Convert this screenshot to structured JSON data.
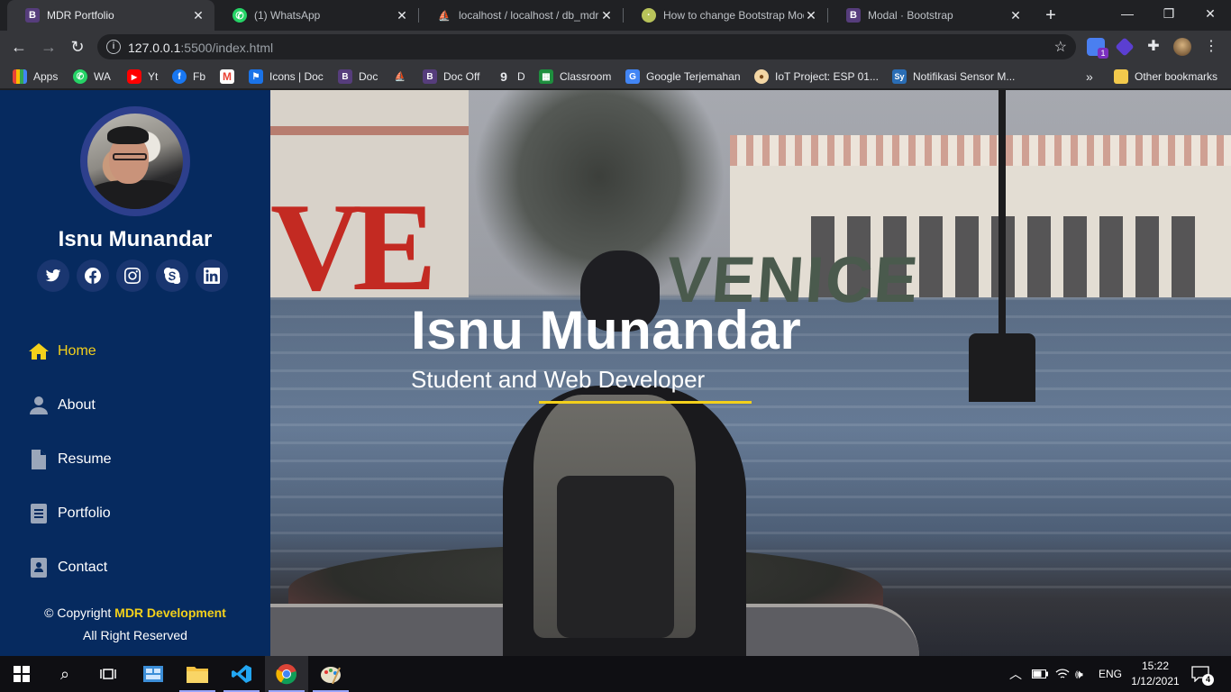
{
  "browser": {
    "tabs": [
      {
        "title": "MDR Portfolio",
        "icon": "bootstrap-icon",
        "active": true
      },
      {
        "title": "(1) WhatsApp",
        "icon": "whatsapp-icon",
        "active": false
      },
      {
        "title": "localhost / localhost / db_mdr",
        "icon": "phpmyadmin-icon",
        "active": false
      },
      {
        "title": "How to change Bootstrap Moda",
        "icon": "stackoverflow-icon",
        "active": false
      },
      {
        "title": "Modal · Bootstrap",
        "icon": "bootstrap-icon",
        "active": false
      }
    ],
    "url_host": "127.0.0.1",
    "url_rest": ":5500/index.html",
    "extension_badge": "1",
    "bookmarks": [
      "Apps",
      "WA",
      "Yt",
      "Fb",
      "",
      "Icons | Doc",
      "Doc",
      "",
      "Doc Off",
      "D",
      "Classroom",
      "Google Terjemahan",
      "IoT Project: ESP 01...",
      "Notifikasi Sensor M..."
    ],
    "bookmarks_more": "»",
    "other_bookmarks": "Other bookmarks"
  },
  "sidebar": {
    "name": "Isnu Munandar",
    "socials": [
      "twitter-icon",
      "facebook-icon",
      "instagram-icon",
      "skype-icon",
      "linkedin-icon"
    ],
    "nav": [
      {
        "label": "Home",
        "icon": "home-icon",
        "active": true
      },
      {
        "label": "About",
        "icon": "user-icon",
        "active": false
      },
      {
        "label": "Resume",
        "icon": "file-icon",
        "active": false
      },
      {
        "label": "Portfolio",
        "icon": "book-icon",
        "active": false
      },
      {
        "label": "Contact",
        "icon": "address-book-icon",
        "active": false
      }
    ],
    "copyright_prefix": "© Copyright",
    "copyright_brand": "MDR Development",
    "rights": "All Right Reserved"
  },
  "hero": {
    "title": "Isnu Munandar",
    "subtitle": "Student and Web Developer"
  },
  "taskbar": {
    "language": "ENG",
    "time": "15:22",
    "date": "1/12/2021",
    "notifications": "4"
  },
  "colors": {
    "sidebar_bg": "#062a5f",
    "accent": "#f3d01b",
    "social_bg": "#1a3670",
    "chrome_dark": "#202124",
    "chrome_toolbar": "#35363a"
  }
}
